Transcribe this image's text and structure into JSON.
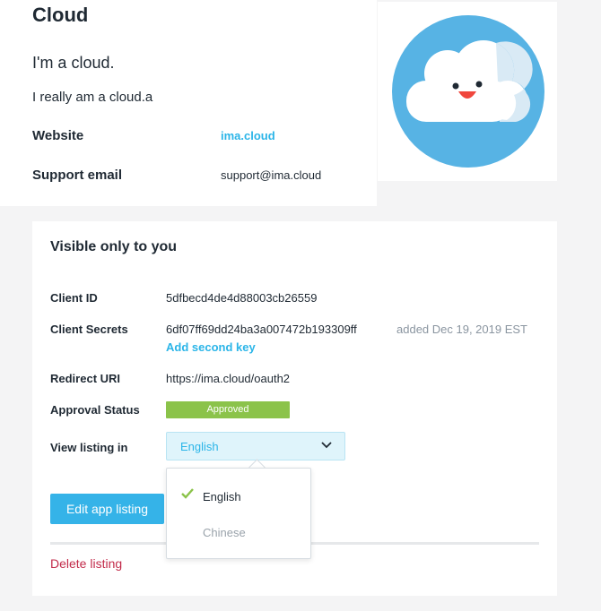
{
  "app": {
    "name": "Cloud",
    "tagline": "I'm a cloud.",
    "description": "I really am a cloud.a",
    "website_label": "Website",
    "website_value": "ima.cloud",
    "support_label": "Support email",
    "support_value": "support@ima.cloud"
  },
  "panel": {
    "title": "Visible only to you",
    "client_id_label": "Client ID",
    "client_id_value": "5dfbecd4de4d88003cb26559",
    "client_secrets_label": "Client Secrets",
    "client_secret_value": "6df07ff69dd24ba3a007472b193309ff",
    "client_secret_added": "added Dec 19, 2019 EST",
    "add_second_key": "Add second key",
    "redirect_label": "Redirect URI",
    "redirect_value": "https://ima.cloud/oauth2",
    "approval_label": "Approval Status",
    "approval_value": "Approved",
    "view_listing_label": "View listing in",
    "view_listing_selected": "English",
    "edit_button": "Edit app listing",
    "delete_link": "Delete listing"
  },
  "dropdown": {
    "options": [
      {
        "label": "English",
        "selected": true
      },
      {
        "label": "Chinese",
        "selected": false
      }
    ]
  },
  "colors": {
    "accent": "#2bb5e8",
    "button": "#35b3e8",
    "approved": "#8bc34a",
    "danger": "#c22b4a",
    "logo_bg": "#57b3e4"
  },
  "icons": {
    "logo": "cloud-face-icon",
    "select_chevron": "chevron-down-icon",
    "selected_check": "check-icon"
  }
}
